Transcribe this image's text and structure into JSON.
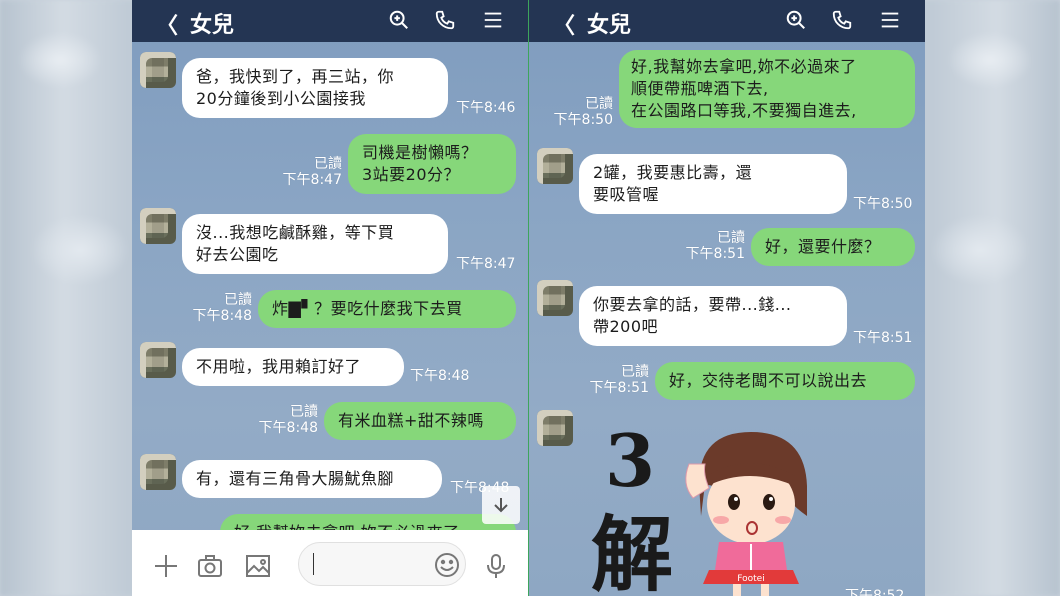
{
  "chat": {
    "title": "女兒",
    "back_glyph": "〈"
  },
  "left_panel": {
    "messages": [
      {
        "dir": "in",
        "text": "爸，我快到了，再三站，你\n20分鐘後到小公園接我",
        "time": "下午8:46"
      },
      {
        "dir": "out",
        "text": "司機是樹懶嗎？\n3站要20分？",
        "read": "已讀",
        "time": "下午8:47"
      },
      {
        "dir": "in",
        "text": "沒...我想吃鹹酥雞，等下買\n好去公園吃",
        "time": "下午8:47"
      },
      {
        "dir": "out",
        "text": "炸▇▘？要吃什麼我下去買",
        "read": "已讀",
        "time": "下午8:48"
      },
      {
        "dir": "in",
        "text": "不用啦，我用賴訂好了",
        "time": "下午8:48"
      },
      {
        "dir": "out",
        "text": "有米血糕+甜不辣嗎",
        "read": "已讀",
        "time": "下午8:48"
      },
      {
        "dir": "in",
        "text": "有，還有三角骨大腸魷魚腳",
        "time": "下午8:48"
      },
      {
        "dir": "out",
        "text": "好,我幫妳去拿吧,妳不必過來了",
        "time": ""
      }
    ],
    "input_placeholder": ""
  },
  "right_panel": {
    "messages": [
      {
        "dir": "out",
        "text": "好,我幫妳去拿吧,妳不必過來了\n順便帶瓶啤酒下去,\n在公園路口等我,不要獨自進去,",
        "read": "已讀",
        "time": "下午8:50"
      },
      {
        "dir": "in",
        "text": "2罐，我要惠比壽，還\n要吸管喔",
        "time": "下午8:50"
      },
      {
        "dir": "out",
        "text": "好，還要什麼？",
        "read": "已讀",
        "time": "下午8:51"
      },
      {
        "dir": "in",
        "text": "你要去拿的話，要帶...錢...\n帶200吧",
        "time": "下午8:51"
      },
      {
        "dir": "out",
        "text": "好，交待老闆不可以說出去",
        "read": "已讀",
        "time": "下午8:51"
      }
    ],
    "sticker": {
      "big_text_1": "3",
      "big_text_2": "解",
      "shirt_text": "Footei"
    },
    "last_time": "下午8:52"
  },
  "colors": {
    "header": "#243553",
    "out_bubble": "#86d77a",
    "in_bubble": "#ffffff",
    "chat_bg": "#8aa5c4"
  },
  "icons": [
    "back-arrow-icon",
    "search-icon",
    "phone-icon",
    "menu-icon",
    "plus-icon",
    "camera-icon",
    "image-icon",
    "emoji-icon",
    "mic-icon",
    "scroll-down-icon"
  ]
}
